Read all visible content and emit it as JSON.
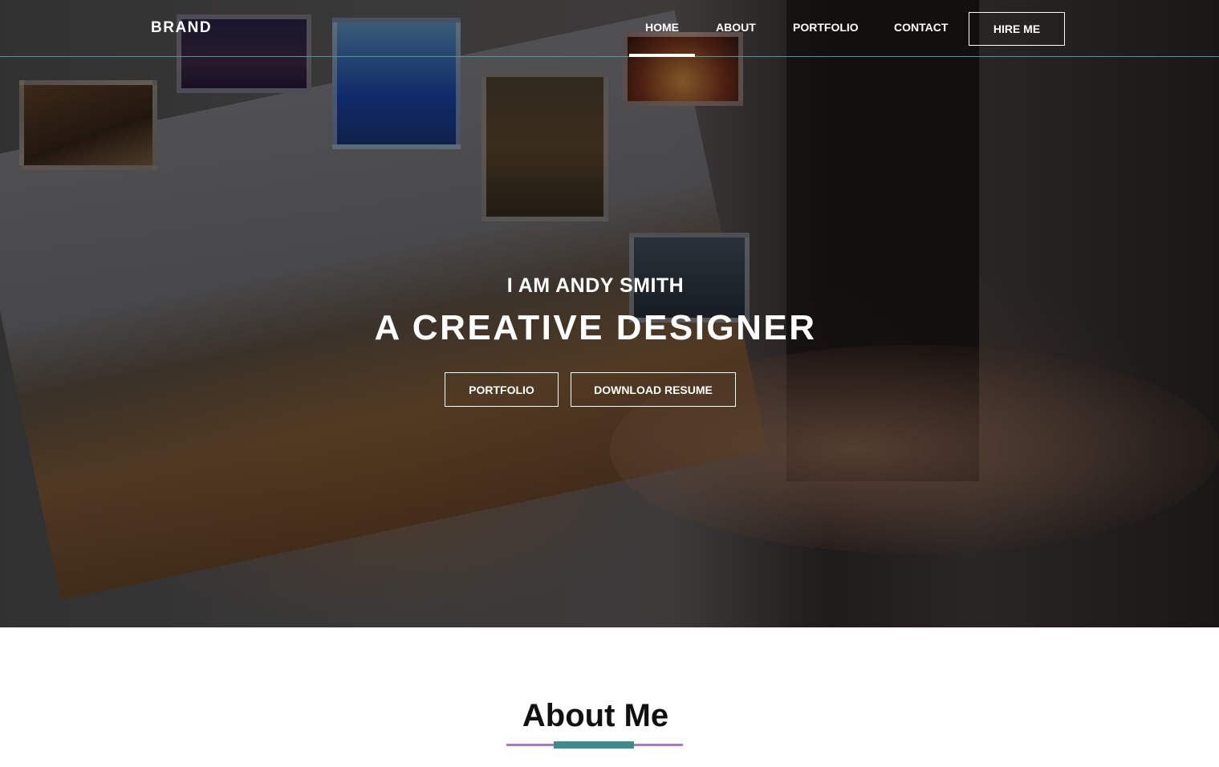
{
  "nav": {
    "brand": "BRAND",
    "items": [
      {
        "label": "HOME",
        "active": true
      },
      {
        "label": "ABOUT",
        "active": false
      },
      {
        "label": "PORTFOLIO",
        "active": false
      },
      {
        "label": "CONTACT",
        "active": false
      }
    ],
    "hire_label": "HIRE ME"
  },
  "hero": {
    "subtitle": "I AM ANDY SMITH",
    "title": "A CREATIVE DESIGNER",
    "buttons": {
      "portfolio": "PORTFOLIO",
      "resume": "DOWNLOAD RESUME"
    }
  },
  "about": {
    "title": "About Me"
  },
  "colors": {
    "accent_teal": "#3f8a8c",
    "accent_purple": "#a47bc4",
    "nav_border": "#4a9a9a"
  }
}
